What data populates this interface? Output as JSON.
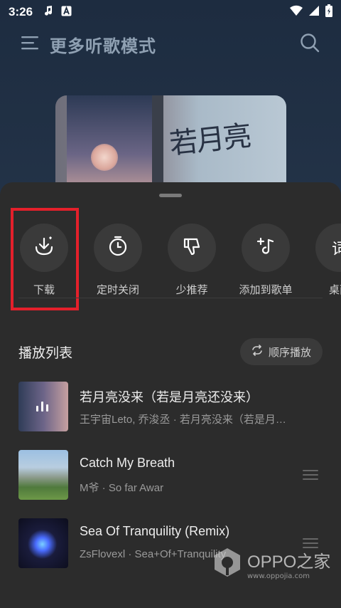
{
  "status_bar": {
    "time": "3:26",
    "left_icons": [
      "music-note-icon",
      "a-badge-icon"
    ],
    "right_icons": [
      "wifi-icon",
      "signal-icon",
      "battery-icon"
    ]
  },
  "header": {
    "title": "更多听歌模式",
    "menu_icon": "menu-icon",
    "search_icon": "search-icon"
  },
  "sheet": {
    "actions": [
      {
        "label": "下载",
        "icon": "download-icon"
      },
      {
        "label": "定时关闭",
        "icon": "timer-icon"
      },
      {
        "label": "少推荐",
        "icon": "dislike-icon"
      },
      {
        "label": "添加到歌单",
        "icon": "add-to-playlist-icon"
      },
      {
        "label": "桌面",
        "icon": "lyrics-icon"
      }
    ],
    "highlight_color": "#e4202b",
    "playlist": {
      "title": "播放列表",
      "order_button": "顺序播放"
    },
    "songs": [
      {
        "title": "若月亮没来（若是月亮还没来）",
        "subtitle": "王宇宙Leto, 乔浚丞 · 若月亮没来（若是月…",
        "playing": true
      },
      {
        "title": "Catch My Breath",
        "subtitle": "M爷 · So far Awar",
        "playing": false
      },
      {
        "title": "Sea Of Tranquility (Remix)",
        "subtitle": "ZsFlovexl · Sea+Of+Tranquility",
        "playing": false
      }
    ]
  },
  "watermark": {
    "main": "OPPO之家",
    "sub": "www.oppojia.com"
  },
  "colors": {
    "sheet_bg": "#2c2c2c",
    "page_bg": "#1d2c40",
    "text_primary": "#ededed",
    "text_secondary": "#9a9a9a"
  }
}
